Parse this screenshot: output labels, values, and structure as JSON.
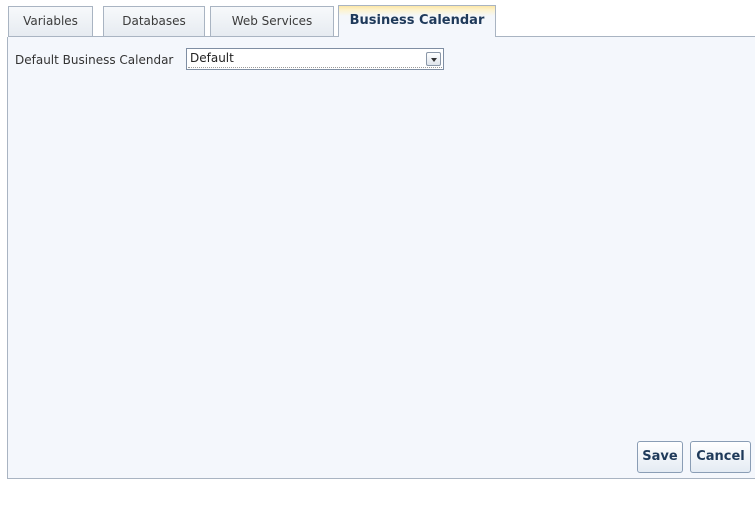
{
  "tabs": [
    {
      "label": "Variables",
      "active": false
    },
    {
      "label": "Databases",
      "active": false
    },
    {
      "label": "Web Services",
      "active": false
    },
    {
      "label": "Business Calendar",
      "active": true
    }
  ],
  "form": {
    "default_calendar_label": "Default Business Calendar",
    "default_calendar_value": "Default"
  },
  "buttons": {
    "save_label": "Save",
    "cancel_label": "Cancel"
  },
  "colors": {
    "panel_background": "#f4f7fc",
    "active_tab_accent": "#fbe6a7",
    "border": "#a9b4c2",
    "button_text": "#1f3a5a"
  },
  "icons": {
    "select_arrow": "chevron-down-icon"
  }
}
